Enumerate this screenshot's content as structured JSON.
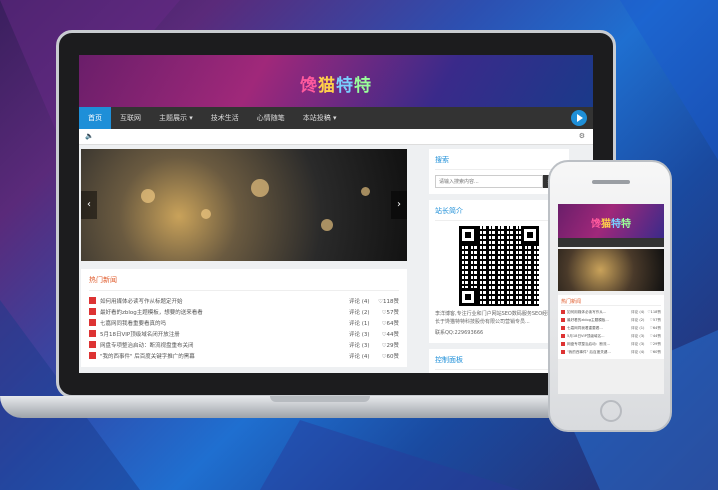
{
  "site": {
    "logo_chars": [
      "馋",
      "猫",
      "特",
      "特"
    ],
    "nav": [
      "首页",
      "互联网",
      "主题展示 ▾",
      "技术生活",
      "心情随笔",
      "本站投稿 ▾"
    ],
    "hot_title": "热门新闻",
    "hot_items": [
      {
        "title": "如何用媒体必读写作从标题定开始",
        "comments": "评论 (4)",
        "views": "♡118赞"
      },
      {
        "title": "最好看的zblog主题模板，想要的送来看看",
        "comments": "评论 (2)",
        "views": "♡57赞"
      },
      {
        "title": "七嘉网同我看重要看真的吗",
        "comments": "评论 (1)",
        "views": "♡64赞"
      },
      {
        "title": "5月18日VIP顶级域名闭开放注册",
        "comments": "评论 (3)",
        "views": "♡44赞"
      },
      {
        "title": "网盘专项整治启动：断流视盘重布关闭",
        "comments": "评论 (3)",
        "views": "♡29赞"
      },
      {
        "title": "\"我的西事件\" 后百度关键字推广的黑幕",
        "comments": "评论 (4)",
        "views": "♡60赞"
      }
    ],
    "search_title": "搜索",
    "search_placeholder": "请输入搜索内容...",
    "search_button": "搜索",
    "about_title": "站长简介",
    "about_text": "李洋博客,专注行业和门户网站SEO数码服务SEO经验，擅长于馋猫特特科技股份有限公司营销专员...",
    "about_contact": "联系QQ:229693666",
    "control_title": "控制面板"
  },
  "phone": {
    "hot_title": "热门新闻",
    "items": [
      {
        "title": "如何用媒体必读写作从...",
        "comments": "评论 (4)",
        "views": "♡118赞"
      },
      {
        "title": "最好看的zblog主题模板...",
        "comments": "评论 (2)",
        "views": "♡57赞"
      },
      {
        "title": "七嘉网同我看重要看...",
        "comments": "评论 (1)",
        "views": "♡64赞"
      },
      {
        "title": "5月18日VIP顶级域名...",
        "comments": "评论 (3)",
        "views": "♡44赞"
      },
      {
        "title": "网盘专项整治启动：断流...",
        "comments": "评论 (3)",
        "views": "♡29赞"
      },
      {
        "title": "\"我的西事件\" 后百度关键...",
        "comments": "评论 (4)",
        "views": "♡60赞"
      }
    ]
  }
}
